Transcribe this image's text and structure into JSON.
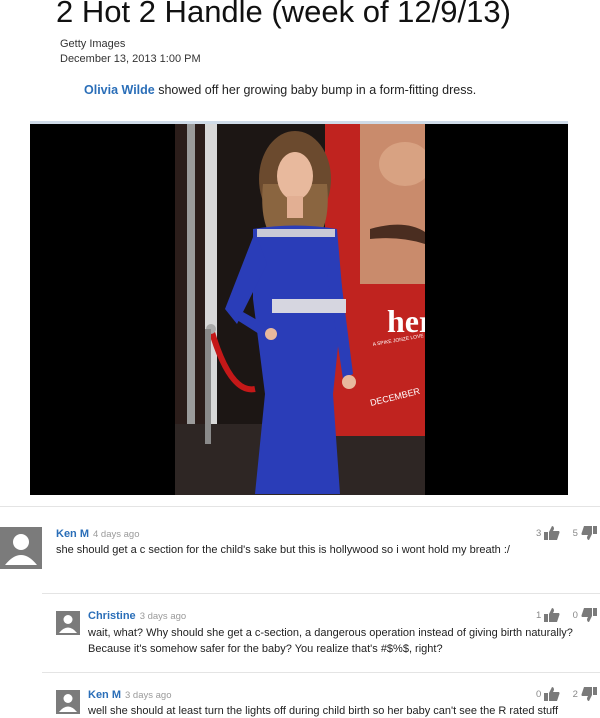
{
  "article": {
    "title": "2 Hot 2 Handle (week of 12/9/13)",
    "credit": "Getty Images",
    "date": "December 13, 2013 1:00 PM",
    "caption_name": "Olivia Wilde",
    "caption_text": " showed off her growing baby bump in a form-fitting dress."
  },
  "photo": {
    "poster_title": "her",
    "poster_credits": "A SPIKE JONZE LOVE STORY",
    "poster_month": "DECEMBER"
  },
  "comments": [
    {
      "author": "Ken M",
      "time": "4 days ago",
      "text": [
        "she should get a c section for the child's sake but this is hollywood so i wont hold my breath :/"
      ],
      "upvotes": "3",
      "downvotes": "5"
    },
    {
      "author": "Christine",
      "time": "3 days ago",
      "text": [
        "wait, what? Why should she get a c-section, a dangerous operation instead of giving birth naturally?",
        "Because it's somehow safer for the baby? You realize that's #$%$, right?"
      ],
      "upvotes": "1",
      "downvotes": "0"
    },
    {
      "author": "Ken M",
      "time": "3 days ago",
      "text": [
        "well she should at least turn the lights off during child birth so her baby can't see the R rated stuff"
      ],
      "upvotes": "0",
      "downvotes": "2"
    }
  ],
  "icons": {
    "thumbs_up": "thumbs-up-icon",
    "thumbs_down": "thumbs-down-icon",
    "avatar": "default-user-avatar"
  },
  "colors": {
    "link_blue": "#2a6eb8",
    "dress_blue": "#2a3db8",
    "poster_red": "#c0231f"
  }
}
